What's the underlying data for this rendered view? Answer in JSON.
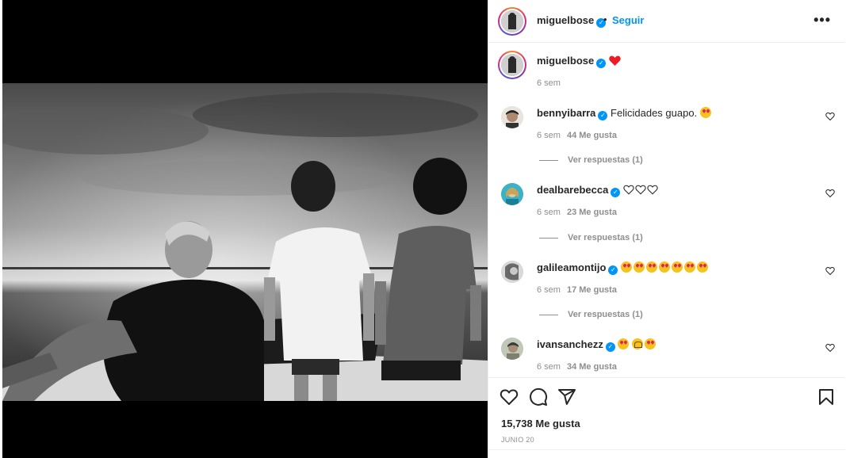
{
  "post": {
    "author": "miguelbose",
    "separator": "•",
    "follow_label": "Seguir",
    "more_label": "•••",
    "caption_time": "6 sem"
  },
  "comments": [
    {
      "user": "bennyibarra",
      "text": "Felicidades guapo.",
      "time": "6 sem",
      "likes": "44 Me gusta",
      "replies": "Ver respuestas (1)"
    },
    {
      "user": "dealbarebecca",
      "text": "",
      "time": "6 sem",
      "likes": "23 Me gusta",
      "replies": "Ver respuestas (1)"
    },
    {
      "user": "galileamontijo",
      "text": "",
      "time": "6 sem",
      "likes": "17 Me gusta",
      "replies": "Ver respuestas (1)"
    },
    {
      "user": "ivansanchezz",
      "text": "",
      "time": "6 sem",
      "likes": "34 Me gusta",
      "replies": ""
    }
  ],
  "footer": {
    "likes": "15,738 Me gusta",
    "date": "JUNIO 20"
  },
  "icons": {
    "like": "heart-outline-icon",
    "comment": "comment-bubble-icon",
    "share": "paper-plane-icon",
    "save": "bookmark-icon",
    "verified": "verified-badge-icon",
    "more": "more-options-icon"
  },
  "colors": {
    "accent": "#0095f6",
    "heart": "#ed1c24",
    "text": "#262626",
    "secondary": "#8e8e8e"
  }
}
